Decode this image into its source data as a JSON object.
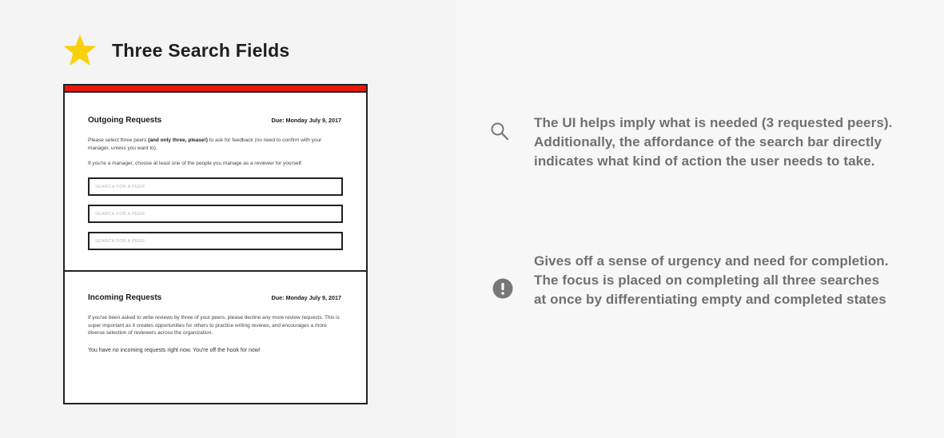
{
  "header": {
    "title": "Three Search Fields",
    "icon": "star-icon",
    "icon_color": "#f7d20c"
  },
  "mock": {
    "accent_color": "#e8190c",
    "outgoing": {
      "title": "Outgoing Requests",
      "due": "Due: Monday July 9, 2017",
      "para1_pre": "Please select three peers ",
      "para1_bold": "(and only three, please!)",
      "para1_post": " to ask for feedback (no need to confirm with your manager, unless you want to).",
      "para2": "If you're a manager, choose at least one of the people you manage as a reviewer for yourself.",
      "searches": [
        {
          "placeholder": "SEARCH FOR A PEER",
          "value": ""
        },
        {
          "placeholder": "SEARCH FOR A PEER",
          "value": ""
        },
        {
          "placeholder": "SEARCH FOR A PEER",
          "value": ""
        }
      ]
    },
    "incoming": {
      "title": "Incoming Requests",
      "due": "Due: Monday July 9, 2017",
      "para1": "If you've been asked to write reviews by three of your peers, please decline any more review requests. This is super important as it creates opportunities for others to practice writing reviews, and encourages a more diverse selection of reviewers across the organization.",
      "para2": "You have no incoming requests right now. You're off the hook for now!"
    }
  },
  "notes": [
    {
      "icon": "search-icon",
      "text": "The UI helps imply what is needed (3 requested peers). Additionally, the affordance of the search bar directly indicates what kind of action the user needs to take."
    },
    {
      "icon": "exclamation-circle-icon",
      "text": "Gives off a sense of urgency and need for completion. The focus is placed on completing all three searches at once by differentiating empty and completed states"
    }
  ]
}
